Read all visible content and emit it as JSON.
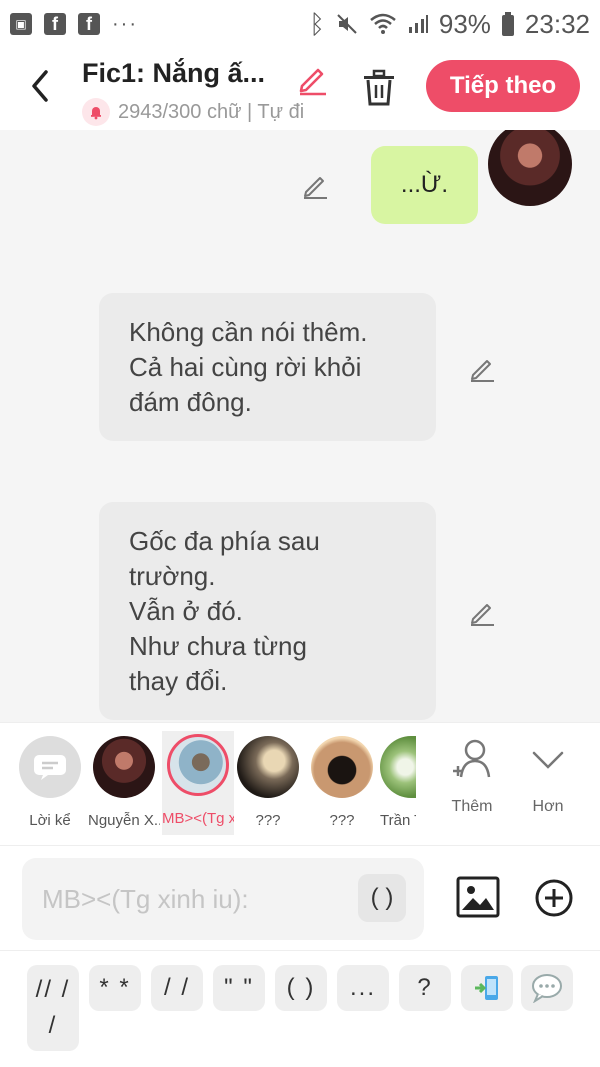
{
  "status_bar": {
    "battery": "93%",
    "time": "23:32",
    "dots": "···"
  },
  "header": {
    "title": "Fic1: Nắng ấ...",
    "subtitle": "2943/300 chữ | Tự đi",
    "next_label": "Tiếp theo"
  },
  "messages": [
    {
      "speaker": "me",
      "text": "...Ừ."
    },
    {
      "speaker": "narration",
      "text": "Không cần nói thêm.\nCả hai cùng rời khỏi\nđám đông."
    },
    {
      "speaker": "narration",
      "text": "Gốc đa phía sau\ntrường.\nVẫn ở đó.\nNhư chưa từng\nthay đổi."
    }
  ],
  "characters": [
    {
      "name": "Lời kể"
    },
    {
      "name": "Nguyễn X..."
    },
    {
      "name": "MB><(Tg x..."
    },
    {
      "name": "???"
    },
    {
      "name": "???"
    },
    {
      "name": "Trần T"
    }
  ],
  "char_actions": {
    "add_label": "Thêm",
    "more_label": "Hơn"
  },
  "input": {
    "placeholder": "MB><(Tg xinh iu):",
    "paren_label": "( )"
  },
  "shortcuts": [
    "// /\n/",
    "* *",
    "/ /",
    "\" \"",
    "( )",
    "...",
    "?"
  ],
  "colors": {
    "accent": "#ee4d68",
    "my_bubble": "#d8f5a2",
    "narration_bubble": "#ebebeb"
  }
}
